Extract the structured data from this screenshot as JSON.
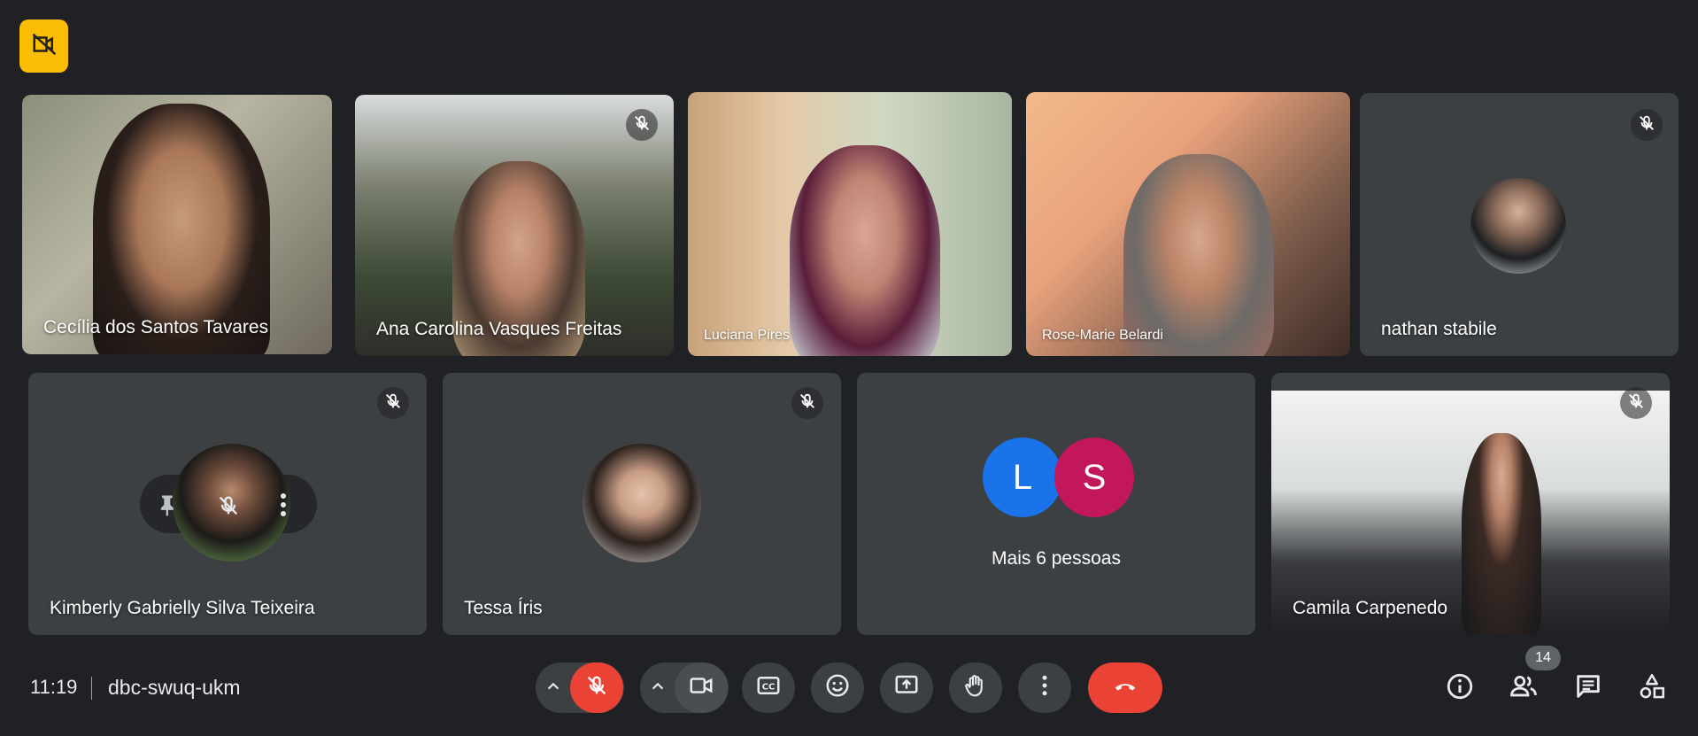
{
  "top": {
    "badge_icon": "camera-off-icon",
    "badge_color": "#fbbc04"
  },
  "participants": [
    {
      "name": "Cecília dos Santos Tavares",
      "muted": false
    },
    {
      "name": "Ana Carolina Vasques Freitas",
      "muted": true
    },
    {
      "name": "Luciana Pires",
      "muted": false
    },
    {
      "name": "Rose-Marie Belardi",
      "muted": false
    },
    {
      "name": "nathan stabile",
      "muted": true
    },
    {
      "name": "Kimberly Gabrielly Silva Teixeira",
      "muted": true
    },
    {
      "name": "Tessa Íris",
      "muted": true
    },
    {
      "name": "Camila Carpenedo",
      "muted": true
    }
  ],
  "more_tile": {
    "initials": [
      "L",
      "S"
    ],
    "colors": [
      "#1a73e8",
      "#c2185b"
    ],
    "label": "Mais 6 pessoas"
  },
  "bottom": {
    "time": "11:19",
    "meeting_code": "dbc-swuq-ukm",
    "people_count": "14",
    "colors": {
      "hangup": "#ea4335",
      "mic_off": "#ea4335",
      "control_bg": "#3c4043"
    }
  }
}
